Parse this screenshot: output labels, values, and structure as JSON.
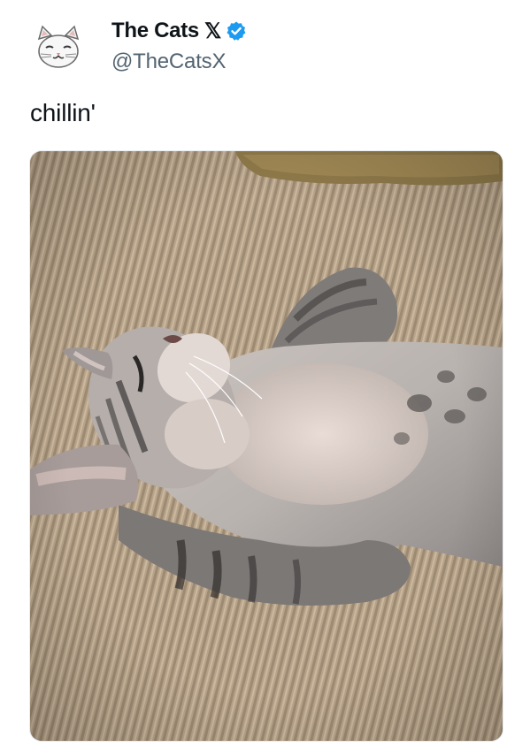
{
  "tweet": {
    "display_name": "The Cats",
    "x_badge": "𝕏",
    "handle": "@TheCatsX",
    "text": "chillin'",
    "verified": true,
    "verified_color": "#1d9bf0"
  },
  "avatar": {
    "icon": "smirking-cat-avatar-icon"
  },
  "media": {
    "icon": "kitten-lying-on-back-photo"
  }
}
